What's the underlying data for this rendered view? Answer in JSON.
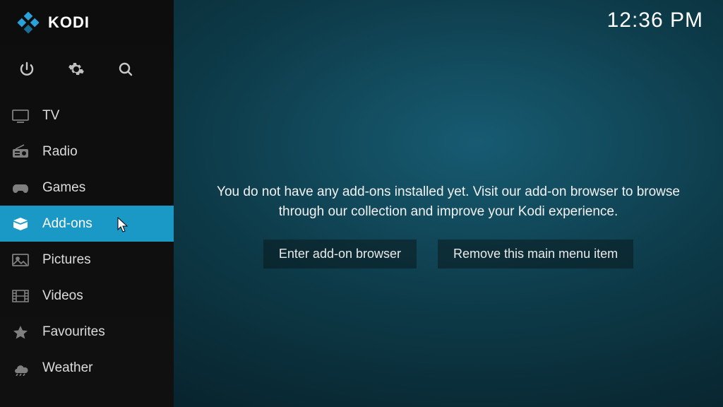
{
  "app": {
    "name": "KODI"
  },
  "clock": "12:36 PM",
  "sidebar": {
    "items": [
      {
        "label": "TV",
        "icon": "tv-icon"
      },
      {
        "label": "Radio",
        "icon": "radio-icon"
      },
      {
        "label": "Games",
        "icon": "gamepad-icon"
      },
      {
        "label": "Add-ons",
        "icon": "box-icon",
        "selected": true
      },
      {
        "label": "Pictures",
        "icon": "picture-icon"
      },
      {
        "label": "Videos",
        "icon": "film-icon"
      },
      {
        "label": "Favourites",
        "icon": "star-icon"
      },
      {
        "label": "Weather",
        "icon": "weather-icon"
      }
    ]
  },
  "main": {
    "message": "You do not have any add-ons installed yet. Visit our add-on browser to browse through our collection and improve your Kodi experience.",
    "enter_browser_label": "Enter add-on browser",
    "remove_item_label": "Remove this main menu item"
  }
}
